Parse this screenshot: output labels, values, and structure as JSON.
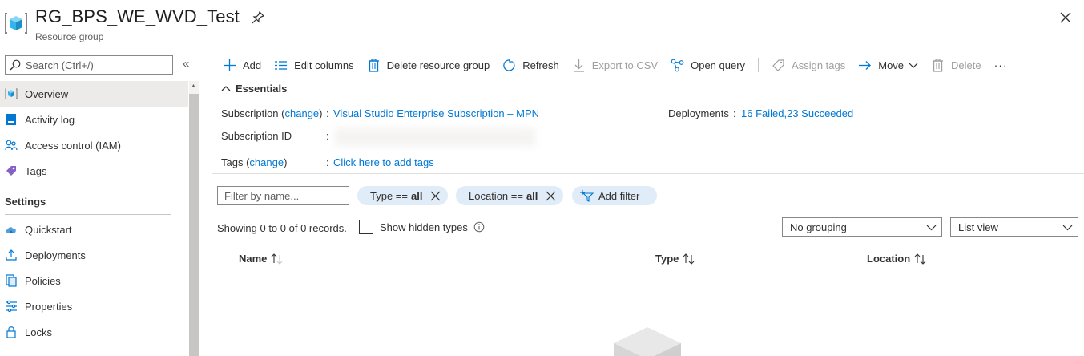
{
  "header": {
    "title": "RG_BPS_WE_WVD_Test",
    "subtitle": "Resource group",
    "icon": "resource-group-icon",
    "pin_icon": "pin-icon",
    "close_icon": "close-icon"
  },
  "search": {
    "placeholder": "Search (Ctrl+/)",
    "value": ""
  },
  "collapse_label": "«",
  "sidebar": {
    "items": [
      {
        "label": "Overview",
        "icon": "overview-icon",
        "selected": true
      },
      {
        "label": "Activity log",
        "icon": "activity-log-icon"
      },
      {
        "label": "Access control (IAM)",
        "icon": "access-control-icon"
      },
      {
        "label": "Tags",
        "icon": "tag-icon"
      }
    ],
    "section": "Settings",
    "settings_items": [
      {
        "label": "Quickstart",
        "icon": "quickstart-icon"
      },
      {
        "label": "Deployments",
        "icon": "deployments-icon"
      },
      {
        "label": "Policies",
        "icon": "policies-icon"
      },
      {
        "label": "Properties",
        "icon": "properties-icon"
      },
      {
        "label": "Locks",
        "icon": "lock-icon"
      }
    ]
  },
  "toolbar": {
    "add": "Add",
    "edit_columns": "Edit columns",
    "delete_group": "Delete resource group",
    "refresh": "Refresh",
    "export_csv": "Export to CSV",
    "open_query": "Open query",
    "assign_tags": "Assign tags",
    "move": "Move",
    "delete": "Delete",
    "more": "···"
  },
  "essentials": {
    "title": "Essentials",
    "subscription_label": "Subscription",
    "change_label": "change",
    "subscription_value": "Visual Studio Enterprise Subscription – MPN",
    "subscription_id_label": "Subscription ID",
    "tags_label": "Tags",
    "tags_value": "Click here to add tags",
    "deployments_label": "Deployments",
    "deployments_value": "16 Failed,23 Succeeded",
    "colon": ":"
  },
  "filters": {
    "placeholder": "Filter by name...",
    "type_label": "Type ==",
    "type_value": "all",
    "location_label": "Location ==",
    "location_value": "all",
    "add_filter": "Add filter"
  },
  "records": {
    "summary": "Showing 0 to 0 of 0 records.",
    "show_hidden": "Show hidden types",
    "show_hidden_checked": false
  },
  "grouping": {
    "selected": "No grouping"
  },
  "view": {
    "selected": "List view"
  },
  "columns": {
    "name": "Name",
    "type": "Type",
    "location": "Location"
  },
  "colors": {
    "accent": "#0078d4",
    "pill_bg": "#e0ecf7",
    "selected_bg": "#edebe9"
  }
}
